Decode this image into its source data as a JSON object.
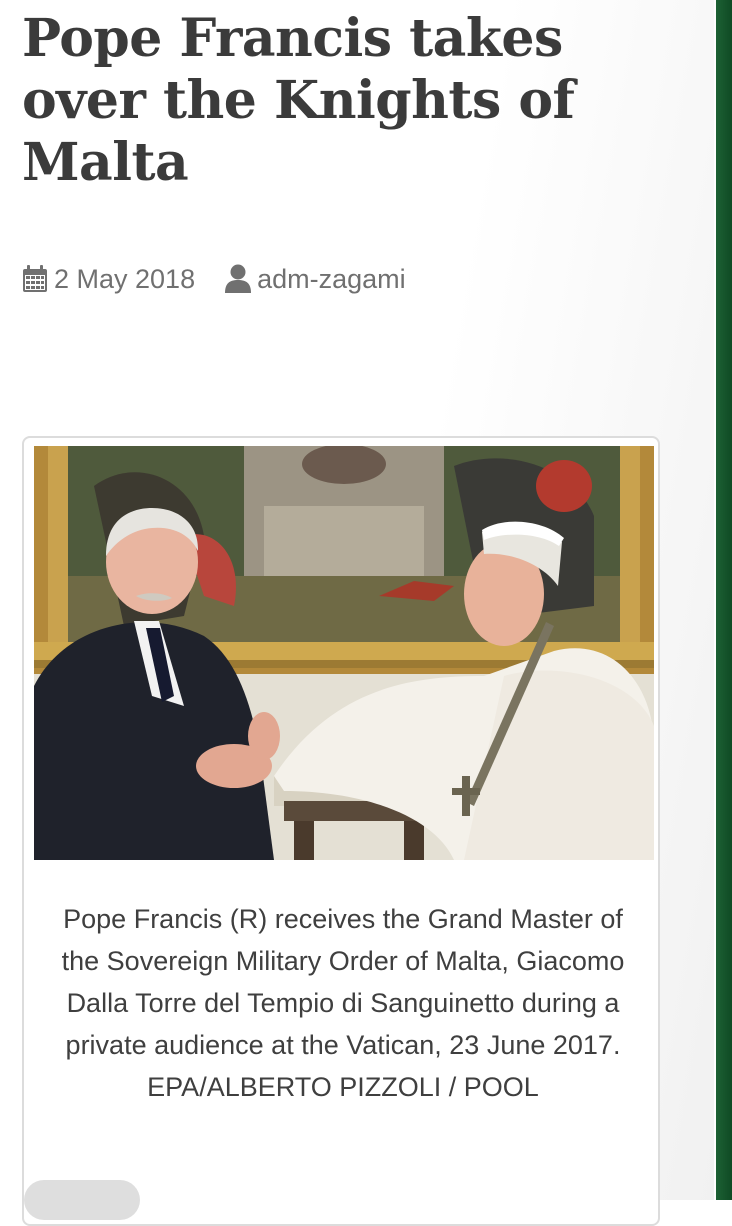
{
  "article": {
    "title": "Pope Francis takes over the Knights of Malta",
    "date": "2 May 2018",
    "author": "adm-zagami"
  },
  "figure": {
    "caption": "Pope Francis (R) receives the Grand Master of the Sovereign Military Order of Malta, Giacomo Dalla Torre del Tempio di Sanguinetto during a private audience at the Vatican, 23 June 2017. EPA/ALBERTO PIZZOLI / POOL"
  },
  "icons": {
    "date": "calendar-icon",
    "author": "user-icon"
  },
  "colors": {
    "accent_strip": "#1d6134",
    "title_text": "#3b3b3b",
    "meta_text": "#707070"
  }
}
